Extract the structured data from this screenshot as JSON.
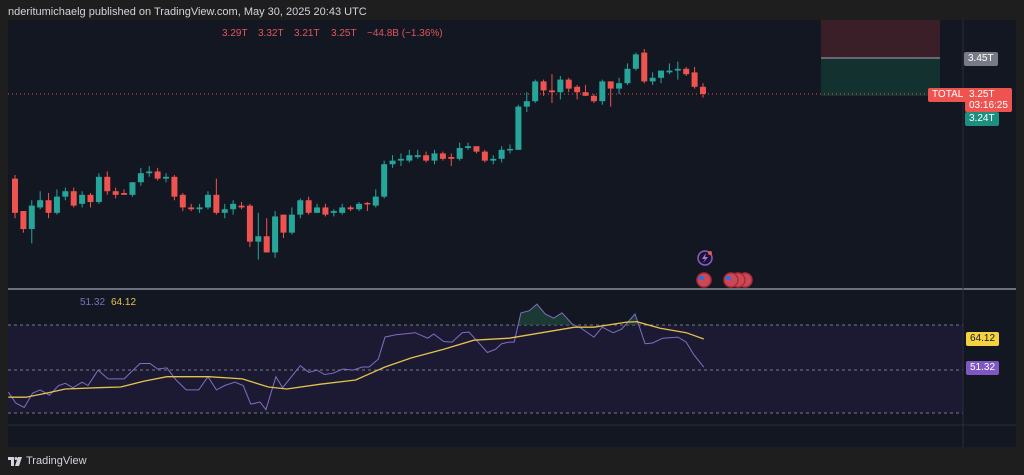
{
  "header": {
    "published": "nderitumichaelg published on TradingView.com, May 30, 2025 20:43 UTC"
  },
  "ohlc": {
    "open": "3.29T",
    "high": "3.32T",
    "low": "3.21T",
    "close": "3.25T",
    "change": "−44.8B (−1.36%)"
  },
  "price_axis": {
    "target": "3.45T",
    "symbol": "TOTAL",
    "last": "3.25T",
    "countdown": "03:16:25",
    "stop": "3.24T"
  },
  "rsi": {
    "value_label": "51.32",
    "ma_label": "64.12"
  },
  "footer": {
    "brand": "TradingView"
  },
  "colors": {
    "up": "#26a69a",
    "down": "#ef5350",
    "rsi": "#7e57c2",
    "ma": "#e5c14d",
    "bg": "#131722"
  },
  "chart_data": [
    {
      "type": "candlestick",
      "symbol": "TOTAL",
      "ylim": [
        2.167,
        3.661
      ],
      "last_price": 3.25,
      "position": {
        "entry": 3.25,
        "target": 3.45,
        "stop_zone_top": 3.661
      },
      "candles": [
        [
          2.78,
          2.8,
          2.56,
          2.59
        ],
        [
          2.6,
          2.6,
          2.48,
          2.5
        ],
        [
          2.5,
          2.66,
          2.42,
          2.63
        ],
        [
          2.62,
          2.71,
          2.61,
          2.66
        ],
        [
          2.66,
          2.7,
          2.56,
          2.59
        ],
        [
          2.59,
          2.72,
          2.58,
          2.68
        ],
        [
          2.68,
          2.73,
          2.66,
          2.71
        ],
        [
          2.71,
          2.73,
          2.62,
          2.63
        ],
        [
          2.64,
          2.71,
          2.62,
          2.69
        ],
        [
          2.69,
          2.7,
          2.62,
          2.65
        ],
        [
          2.65,
          2.81,
          2.64,
          2.79
        ],
        [
          2.79,
          2.82,
          2.69,
          2.71
        ],
        [
          2.71,
          2.73,
          2.67,
          2.69
        ],
        [
          2.7,
          2.72,
          2.69,
          2.69
        ],
        [
          2.69,
          2.76,
          2.68,
          2.76
        ],
        [
          2.76,
          2.84,
          2.74,
          2.81
        ],
        [
          2.81,
          2.85,
          2.79,
          2.82
        ],
        [
          2.82,
          2.84,
          2.77,
          2.78
        ],
        [
          2.78,
          2.81,
          2.76,
          2.79
        ],
        [
          2.79,
          2.8,
          2.66,
          2.68
        ],
        [
          2.69,
          2.7,
          2.6,
          2.62
        ],
        [
          2.62,
          2.64,
          2.6,
          2.61
        ],
        [
          2.61,
          2.64,
          2.59,
          2.62
        ],
        [
          2.62,
          2.71,
          2.61,
          2.69
        ],
        [
          2.69,
          2.78,
          2.58,
          2.59
        ],
        [
          2.59,
          2.64,
          2.56,
          2.61
        ],
        [
          2.61,
          2.66,
          2.58,
          2.64
        ],
        [
          2.63,
          2.65,
          2.61,
          2.62
        ],
        [
          2.63,
          2.64,
          2.4,
          2.43
        ],
        [
          2.43,
          2.59,
          2.33,
          2.46
        ],
        [
          2.46,
          2.56,
          2.37,
          2.37
        ],
        [
          2.37,
          2.6,
          2.34,
          2.57
        ],
        [
          2.58,
          2.58,
          2.45,
          2.48
        ],
        [
          2.48,
          2.62,
          2.47,
          2.58
        ],
        [
          2.58,
          2.67,
          2.56,
          2.66
        ],
        [
          2.66,
          2.68,
          2.58,
          2.59
        ],
        [
          2.59,
          2.64,
          2.59,
          2.62
        ],
        [
          2.62,
          2.64,
          2.57,
          2.58
        ],
        [
          2.59,
          2.61,
          2.57,
          2.6
        ],
        [
          2.59,
          2.64,
          2.58,
          2.62
        ],
        [
          2.62,
          2.63,
          2.6,
          2.61
        ],
        [
          2.61,
          2.65,
          2.6,
          2.64
        ],
        [
          2.645,
          2.65,
          2.6,
          2.64
        ],
        [
          2.63,
          2.72,
          2.62,
          2.68
        ],
        [
          2.68,
          2.88,
          2.67,
          2.86
        ],
        [
          2.86,
          2.91,
          2.84,
          2.88
        ],
        [
          2.88,
          2.92,
          2.85,
          2.89
        ],
        [
          2.88,
          2.94,
          2.87,
          2.91
        ],
        [
          2.9,
          2.94,
          2.89,
          2.91
        ],
        [
          2.91,
          2.93,
          2.87,
          2.88
        ],
        [
          2.88,
          2.94,
          2.86,
          2.92
        ],
        [
          2.92,
          2.93,
          2.88,
          2.89
        ],
        [
          2.9,
          2.92,
          2.85,
          2.89
        ],
        [
          2.89,
          2.98,
          2.88,
          2.95
        ],
        [
          2.95,
          2.98,
          2.94,
          2.96
        ],
        [
          2.96,
          2.96,
          2.92,
          2.93
        ],
        [
          2.93,
          2.94,
          2.87,
          2.88
        ],
        [
          2.88,
          2.91,
          2.86,
          2.89
        ],
        [
          2.89,
          2.96,
          2.87,
          2.94
        ],
        [
          2.94,
          2.97,
          2.92,
          2.945
        ],
        [
          2.94,
          3.19,
          2.94,
          3.18
        ],
        [
          3.18,
          3.26,
          3.15,
          3.21
        ],
        [
          3.21,
          3.33,
          3.2,
          3.32
        ],
        [
          3.32,
          3.33,
          3.24,
          3.27
        ],
        [
          3.27,
          3.36,
          3.2,
          3.26
        ],
        [
          3.26,
          3.35,
          3.22,
          3.33
        ],
        [
          3.33,
          3.34,
          3.26,
          3.28
        ],
        [
          3.29,
          3.3,
          3.22,
          3.26
        ],
        [
          3.26,
          3.3,
          3.24,
          3.24
        ],
        [
          3.24,
          3.25,
          3.2,
          3.21
        ],
        [
          3.21,
          3.33,
          3.19,
          3.32
        ],
        [
          3.32,
          3.32,
          3.18,
          3.28
        ],
        [
          3.28,
          3.34,
          3.25,
          3.31
        ],
        [
          3.31,
          3.42,
          3.3,
          3.39
        ],
        [
          3.39,
          3.48,
          3.38,
          3.47
        ],
        [
          3.48,
          3.5,
          3.31,
          3.32
        ],
        [
          3.32,
          3.37,
          3.3,
          3.34
        ],
        [
          3.34,
          3.38,
          3.31,
          3.38
        ],
        [
          3.37,
          3.42,
          3.36,
          3.38
        ],
        [
          3.38,
          3.43,
          3.33,
          3.39
        ],
        [
          3.39,
          3.4,
          3.35,
          3.36
        ],
        [
          3.37,
          3.4,
          3.28,
          3.29
        ],
        [
          3.29,
          3.31,
          3.23,
          3.25
        ]
      ]
    },
    {
      "type": "line",
      "name": "RSI",
      "ylim": [
        15.5,
        86.4
      ],
      "bands": [
        30,
        50,
        70
      ],
      "rsi": [
        [
          -0.8,
          40
        ],
        [
          0.1,
          35
        ],
        [
          1.1,
          33
        ],
        [
          2.1,
          39.5
        ],
        [
          3.0,
          41
        ],
        [
          4.1,
          38.6
        ],
        [
          5.2,
          43
        ],
        [
          6.0,
          44
        ],
        [
          6.9,
          42
        ],
        [
          8.0,
          44.5
        ],
        [
          8.7,
          43
        ],
        [
          9.9,
          50
        ],
        [
          11.1,
          46
        ],
        [
          13.0,
          46
        ],
        [
          14.9,
          53
        ],
        [
          16.1,
          53
        ],
        [
          17.0,
          50.5
        ],
        [
          18.1,
          51
        ],
        [
          19.2,
          45.5
        ],
        [
          20.4,
          41
        ],
        [
          21.9,
          41
        ],
        [
          23.0,
          47
        ],
        [
          24.0,
          41
        ],
        [
          25.0,
          43
        ],
        [
          26.2,
          44.5
        ],
        [
          27.2,
          43
        ],
        [
          28.1,
          34.5
        ],
        [
          29.2,
          35.5
        ],
        [
          29.9,
          32
        ],
        [
          31.1,
          47
        ],
        [
          31.9,
          42
        ],
        [
          34.0,
          52
        ],
        [
          35.0,
          49
        ],
        [
          36.0,
          50
        ],
        [
          36.9,
          48
        ],
        [
          37.9,
          48.6
        ],
        [
          39.1,
          50.5
        ],
        [
          40.3,
          50
        ],
        [
          41.4,
          51.4
        ],
        [
          42.2,
          51.4
        ],
        [
          43.3,
          55
        ],
        [
          44.1,
          65
        ],
        [
          45.3,
          66
        ],
        [
          47.7,
          67
        ],
        [
          49.2,
          64.5
        ],
        [
          49.9,
          66.4
        ],
        [
          51.1,
          63
        ],
        [
          52.1,
          62.7
        ],
        [
          53.3,
          67
        ],
        [
          54.1,
          67.3
        ],
        [
          55.2,
          62.7
        ],
        [
          56.3,
          58
        ],
        [
          57.3,
          59.5
        ],
        [
          58.0,
          62
        ],
        [
          58.9,
          62.7
        ],
        [
          59.5,
          62.7
        ],
        [
          60.3,
          76
        ],
        [
          61.3,
          77
        ],
        [
          62.2,
          80
        ],
        [
          63.2,
          75.5
        ],
        [
          64.2,
          73.6
        ],
        [
          65.2,
          76
        ],
        [
          66.4,
          71
        ],
        [
          67.5,
          69
        ],
        [
          69.0,
          65
        ],
        [
          70.0,
          69.5
        ],
        [
          71.3,
          67
        ],
        [
          72.3,
          68.6
        ],
        [
          73.9,
          75.5
        ],
        [
          75.1,
          62
        ],
        [
          76.0,
          62.3
        ],
        [
          77.2,
          64.5
        ],
        [
          79.0,
          65
        ],
        [
          80.0,
          62.7
        ],
        [
          80.9,
          57
        ],
        [
          82.1,
          51.32
        ]
      ],
      "ma": [
        [
          -0.8,
          37.7
        ],
        [
          1.3,
          37.7
        ],
        [
          3.7,
          39.5
        ],
        [
          6.0,
          41.4
        ],
        [
          9.9,
          42
        ],
        [
          12.6,
          42.3
        ],
        [
          15.4,
          45
        ],
        [
          18.1,
          47
        ],
        [
          23.1,
          47
        ],
        [
          27.1,
          46
        ],
        [
          30.2,
          42.3
        ],
        [
          32.4,
          41.4
        ],
        [
          36.4,
          43.6
        ],
        [
          40.6,
          45.5
        ],
        [
          44.1,
          51.4
        ],
        [
          47.2,
          55.5
        ],
        [
          51.1,
          59.5
        ],
        [
          54.7,
          63.6
        ],
        [
          58.9,
          64.5
        ],
        [
          62.8,
          67
        ],
        [
          66.7,
          69.5
        ],
        [
          69.0,
          69.5
        ],
        [
          72.9,
          71.8
        ],
        [
          74.1,
          72
        ],
        [
          76.9,
          69
        ],
        [
          80.0,
          67
        ],
        [
          82.1,
          64.12
        ]
      ]
    }
  ]
}
